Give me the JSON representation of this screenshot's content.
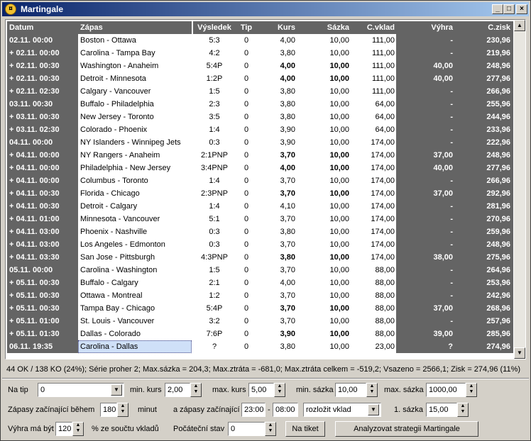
{
  "window": {
    "title": "Martingale",
    "icon": "app-coin-icon"
  },
  "columns": [
    "Datum",
    "Zápas",
    "Výsledek",
    "Tip",
    "Kurs",
    "Sázka",
    "C.vklad",
    "Výhra",
    "C.zisk"
  ],
  "rows": [
    {
      "datum": "02.11. 00:00",
      "zapas": "Boston - Ottawa",
      "vysledek": "5:3",
      "tip": "0",
      "kurs": "4,00",
      "sazka": "10,00",
      "cvklad": "111,00",
      "vyhra": "-",
      "czisk": "230,96",
      "win": false
    },
    {
      "datum": "+ 02.11. 00:00",
      "zapas": "Carolina - Tampa Bay",
      "vysledek": "4:2",
      "tip": "0",
      "kurs": "3,80",
      "sazka": "10,00",
      "cvklad": "111,00",
      "vyhra": "-",
      "czisk": "219,96",
      "win": false
    },
    {
      "datum": "+ 02.11. 00:30",
      "zapas": "Washington - Anaheim",
      "vysledek": "5:4P",
      "tip": "0",
      "kurs": "4,00",
      "sazka": "10,00",
      "cvklad": "111,00",
      "vyhra": "40,00",
      "czisk": "248,96",
      "win": true
    },
    {
      "datum": "+ 02.11. 00:30",
      "zapas": "Detroit - Minnesota",
      "vysledek": "1:2P",
      "tip": "0",
      "kurs": "4,00",
      "sazka": "10,00",
      "cvklad": "111,00",
      "vyhra": "40,00",
      "czisk": "277,96",
      "win": true
    },
    {
      "datum": "+ 02.11. 02:30",
      "zapas": "Calgary - Vancouver",
      "vysledek": "1:5",
      "tip": "0",
      "kurs": "3,80",
      "sazka": "10,00",
      "cvklad": "111,00",
      "vyhra": "-",
      "czisk": "266,96",
      "win": false
    },
    {
      "datum": "03.11. 00:30",
      "zapas": "Buffalo - Philadelphia",
      "vysledek": "2:3",
      "tip": "0",
      "kurs": "3,80",
      "sazka": "10,00",
      "cvklad": "64,00",
      "vyhra": "-",
      "czisk": "255,96",
      "win": false
    },
    {
      "datum": "+ 03.11. 00:30",
      "zapas": "New Jersey - Toronto",
      "vysledek": "3:5",
      "tip": "0",
      "kurs": "3,80",
      "sazka": "10,00",
      "cvklad": "64,00",
      "vyhra": "-",
      "czisk": "244,96",
      "win": false
    },
    {
      "datum": "+ 03.11. 02:30",
      "zapas": "Colorado - Phoenix",
      "vysledek": "1:4",
      "tip": "0",
      "kurs": "3,90",
      "sazka": "10,00",
      "cvklad": "64,00",
      "vyhra": "-",
      "czisk": "233,96",
      "win": false
    },
    {
      "datum": "04.11. 00:00",
      "zapas": "NY Islanders - Winnipeg Jets",
      "vysledek": "0:3",
      "tip": "0",
      "kurs": "3,90",
      "sazka": "10,00",
      "cvklad": "174,00",
      "vyhra": "-",
      "czisk": "222,96",
      "win": false
    },
    {
      "datum": "+ 04.11. 00:00",
      "zapas": "NY Rangers - Anaheim",
      "vysledek": "2:1PNP",
      "tip": "0",
      "kurs": "3,70",
      "sazka": "10,00",
      "cvklad": "174,00",
      "vyhra": "37,00",
      "czisk": "248,96",
      "win": true
    },
    {
      "datum": "+ 04.11. 00:00",
      "zapas": "Philadelphia - New Jersey",
      "vysledek": "3:4PNP",
      "tip": "0",
      "kurs": "4,00",
      "sazka": "10,00",
      "cvklad": "174,00",
      "vyhra": "40,00",
      "czisk": "277,96",
      "win": true
    },
    {
      "datum": "+ 04.11. 00:00",
      "zapas": "Columbus - Toronto",
      "vysledek": "1:4",
      "tip": "0",
      "kurs": "3,70",
      "sazka": "10,00",
      "cvklad": "174,00",
      "vyhra": "-",
      "czisk": "266,96",
      "win": false
    },
    {
      "datum": "+ 04.11. 00:30",
      "zapas": "Florida - Chicago",
      "vysledek": "2:3PNP",
      "tip": "0",
      "kurs": "3,70",
      "sazka": "10,00",
      "cvklad": "174,00",
      "vyhra": "37,00",
      "czisk": "292,96",
      "win": true
    },
    {
      "datum": "+ 04.11. 00:30",
      "zapas": "Detroit - Calgary",
      "vysledek": "1:4",
      "tip": "0",
      "kurs": "4,10",
      "sazka": "10,00",
      "cvklad": "174,00",
      "vyhra": "-",
      "czisk": "281,96",
      "win": false
    },
    {
      "datum": "+ 04.11. 01:00",
      "zapas": "Minnesota - Vancouver",
      "vysledek": "5:1",
      "tip": "0",
      "kurs": "3,70",
      "sazka": "10,00",
      "cvklad": "174,00",
      "vyhra": "-",
      "czisk": "270,96",
      "win": false
    },
    {
      "datum": "+ 04.11. 03:00",
      "zapas": "Phoenix - Nashville",
      "vysledek": "0:3",
      "tip": "0",
      "kurs": "3,80",
      "sazka": "10,00",
      "cvklad": "174,00",
      "vyhra": "-",
      "czisk": "259,96",
      "win": false
    },
    {
      "datum": "+ 04.11. 03:00",
      "zapas": "Los Angeles - Edmonton",
      "vysledek": "0:3",
      "tip": "0",
      "kurs": "3,70",
      "sazka": "10,00",
      "cvklad": "174,00",
      "vyhra": "-",
      "czisk": "248,96",
      "win": false
    },
    {
      "datum": "+ 04.11. 03:30",
      "zapas": "San Jose - Pittsburgh",
      "vysledek": "4:3PNP",
      "tip": "0",
      "kurs": "3,80",
      "sazka": "10,00",
      "cvklad": "174,00",
      "vyhra": "38,00",
      "czisk": "275,96",
      "win": true
    },
    {
      "datum": "05.11. 00:00",
      "zapas": "Carolina - Washington",
      "vysledek": "1:5",
      "tip": "0",
      "kurs": "3,70",
      "sazka": "10,00",
      "cvklad": "88,00",
      "vyhra": "-",
      "czisk": "264,96",
      "win": false
    },
    {
      "datum": "+ 05.11. 00:30",
      "zapas": "Buffalo - Calgary",
      "vysledek": "2:1",
      "tip": "0",
      "kurs": "4,00",
      "sazka": "10,00",
      "cvklad": "88,00",
      "vyhra": "-",
      "czisk": "253,96",
      "win": false
    },
    {
      "datum": "+ 05.11. 00:30",
      "zapas": "Ottawa - Montreal",
      "vysledek": "1:2",
      "tip": "0",
      "kurs": "3,70",
      "sazka": "10,00",
      "cvklad": "88,00",
      "vyhra": "-",
      "czisk": "242,96",
      "win": false
    },
    {
      "datum": "+ 05.11. 00:30",
      "zapas": "Tampa Bay - Chicago",
      "vysledek": "5:4P",
      "tip": "0",
      "kurs": "3,70",
      "sazka": "10,00",
      "cvklad": "88,00",
      "vyhra": "37,00",
      "czisk": "268,96",
      "win": true
    },
    {
      "datum": "+ 05.11. 01:00",
      "zapas": "St. Louis - Vancouver",
      "vysledek": "3:2",
      "tip": "0",
      "kurs": "3,70",
      "sazka": "10,00",
      "cvklad": "88,00",
      "vyhra": "-",
      "czisk": "257,96",
      "win": false
    },
    {
      "datum": "+ 05.11. 01:30",
      "zapas": "Dallas - Colorado",
      "vysledek": "7:6P",
      "tip": "0",
      "kurs": "3,90",
      "sazka": "10,00",
      "cvklad": "88,00",
      "vyhra": "39,00",
      "czisk": "285,96",
      "win": true
    },
    {
      "datum": "06.11. 19:35",
      "zapas": "Carolina - Dallas",
      "vysledek": "?",
      "tip": "0",
      "kurs": "3,80",
      "sazka": "10,00",
      "cvklad": "23,00",
      "vyhra": "?",
      "czisk": "274,96",
      "win": false,
      "selected": true
    }
  ],
  "status": "44 OK / 138 KO (24%); Série proher 2; Max.sázka = 204,3; Max.ztráta = -681,0; Max.ztráta celkem = -519,2; Vsazeno = 2566,1; Zisk = 274,96 (11%)",
  "form": {
    "na_tip_label": "Na tip",
    "na_tip_value": "0",
    "min_kurs_label": "min. kurs",
    "min_kurs_value": "2,00",
    "max_kurs_label": "max. kurs",
    "max_kurs_value": "5,00",
    "min_sazka_label": "min. sázka",
    "min_sazka_value": "10,00",
    "max_sazka_label": "max. sázka",
    "max_sazka_value": "1000,00",
    "zapasy_label": "Zápasy začínající během",
    "zapasy_value": "180",
    "minut_label": "minut",
    "a_zapasy_label": "a zápasy začínající",
    "time_from": "23:00",
    "time_dash": "-",
    "time_to": "08:00",
    "rozlozit_value": "rozložit vklad",
    "prvni_sazka_label": "1. sázka",
    "prvni_sazka_value": "15,00",
    "vyhra_label": "Výhra má být",
    "vyhra_value": "120",
    "procent_label": "% ze součtu vkladů",
    "pocatecni_label": "Počáteční stav",
    "pocatecni_value": "0",
    "na_tiket_button": "Na tiket",
    "analyzovat_button": "Analyzovat strategii Martingale"
  },
  "colors": {
    "dark_column": "#646464",
    "titlebar": "#0a246a",
    "face": "#d4d0c8"
  }
}
